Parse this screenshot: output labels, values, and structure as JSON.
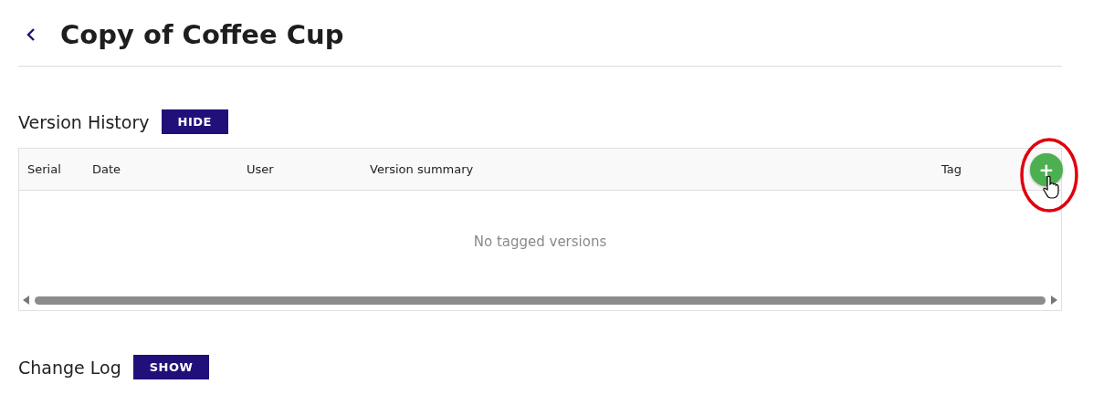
{
  "page": {
    "title": "Copy of Coffee Cup"
  },
  "sections": [
    {
      "title": "Version History",
      "toggle": "HIDE",
      "table": {
        "columns": [
          "Serial",
          "Date",
          "User",
          "Version summary",
          "Tag"
        ],
        "add_button": "+",
        "empty_message": "No tagged versions"
      }
    },
    {
      "title": "Change Log",
      "toggle": "SHOW"
    }
  ]
}
